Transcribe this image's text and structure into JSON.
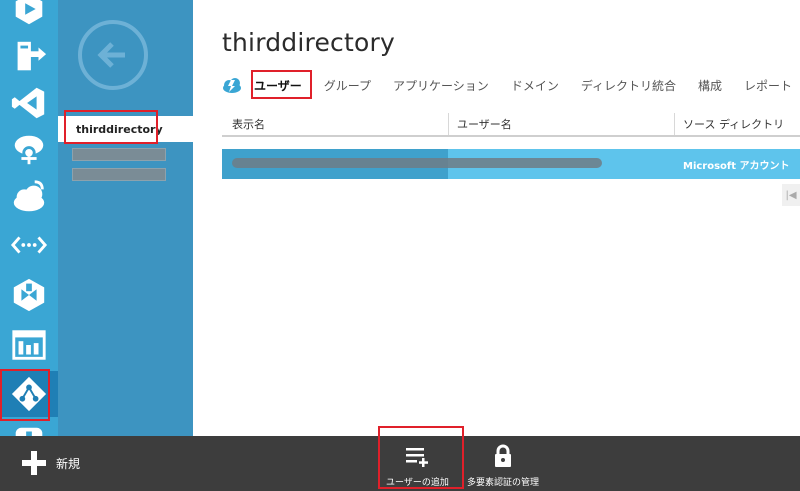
{
  "rail": {
    "items": [
      {
        "icon": "media-services-icon"
      },
      {
        "icon": "deploy-icon"
      },
      {
        "icon": "visual-studio-icon"
      },
      {
        "icon": "hdinsight-icon"
      },
      {
        "icon": "cloud-services-icon"
      },
      {
        "icon": "networks-icon"
      },
      {
        "icon": "traffic-manager-icon"
      },
      {
        "icon": "management-portal-icon"
      },
      {
        "icon": "active-directory-icon",
        "selected": true
      },
      {
        "icon": "add-ons-icon"
      }
    ]
  },
  "subnav": {
    "back_icon": "back-arrow-icon",
    "selected_directory": "thirddirectory"
  },
  "main": {
    "title": "thirddirectory",
    "tabs": [
      {
        "label": "ユーザー",
        "active": true
      },
      {
        "label": "グループ"
      },
      {
        "label": "アプリケーション"
      },
      {
        "label": "ドメイン"
      },
      {
        "label": "ディレクトリ統合"
      },
      {
        "label": "構成"
      },
      {
        "label": "レポート"
      }
    ],
    "table": {
      "headers": [
        "表示名",
        "ユーザー名",
        "ソース ディレクトリ"
      ],
      "rows": [
        {
          "source": "Microsoft アカウント"
        }
      ]
    }
  },
  "commandbar": {
    "new_label": "新規",
    "add_user_label": "ユーザーの追加",
    "mfa_label": "多要素認証の管理"
  },
  "colors": {
    "rail": "#3aa6d4",
    "subnav": "#3d94c1",
    "selected_row": "#5ec4ec",
    "commandbar": "#3d3d3d",
    "highlight": "#e0202a"
  }
}
